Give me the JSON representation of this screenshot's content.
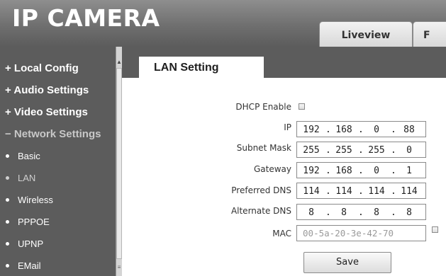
{
  "header": {
    "brand": "IP CAMERA",
    "tabs": [
      {
        "label": "Liveview"
      },
      {
        "label": "F"
      }
    ]
  },
  "sidebar": {
    "sections": [
      {
        "label": "+ Local Config"
      },
      {
        "label": "+ Audio Settings"
      },
      {
        "label": "+ Video Settings"
      },
      {
        "label": "− Network Settings",
        "expanded": true
      }
    ],
    "network_items": [
      {
        "label": "Basic"
      },
      {
        "label": "LAN",
        "selected": true
      },
      {
        "label": "Wireless"
      },
      {
        "label": "PPPOE"
      },
      {
        "label": "UPNP"
      },
      {
        "label": "EMail"
      }
    ],
    "scroll": {
      "up": "▲",
      "down": "≡"
    }
  },
  "content": {
    "tab": "LAN Setting",
    "dhcp": {
      "label": "DHCP Enable",
      "checked": false
    },
    "ip": {
      "label": "IP",
      "octets": [
        "192",
        "168",
        "0",
        "88"
      ]
    },
    "subnet": {
      "label": "Subnet Mask",
      "octets": [
        "255",
        "255",
        "255",
        "0"
      ]
    },
    "gateway": {
      "label": "Gateway",
      "octets": [
        "192",
        "168",
        "0",
        "1"
      ]
    },
    "dns1": {
      "label": "Preferred DNS",
      "octets": [
        "114",
        "114",
        "114",
        "114"
      ]
    },
    "dns2": {
      "label": "Alternate DNS",
      "octets": [
        "8",
        "8",
        "8",
        "8"
      ]
    },
    "mac": {
      "label": "MAC",
      "parts": [
        "00",
        "5a",
        "20",
        "3e",
        "42",
        "70"
      ],
      "editable_checked": false
    },
    "save_label": "Save"
  },
  "colors": {
    "header_gray": "#6f6f6f",
    "sidebar_gray": "#5c5c5c",
    "text_dark": "#333333"
  }
}
